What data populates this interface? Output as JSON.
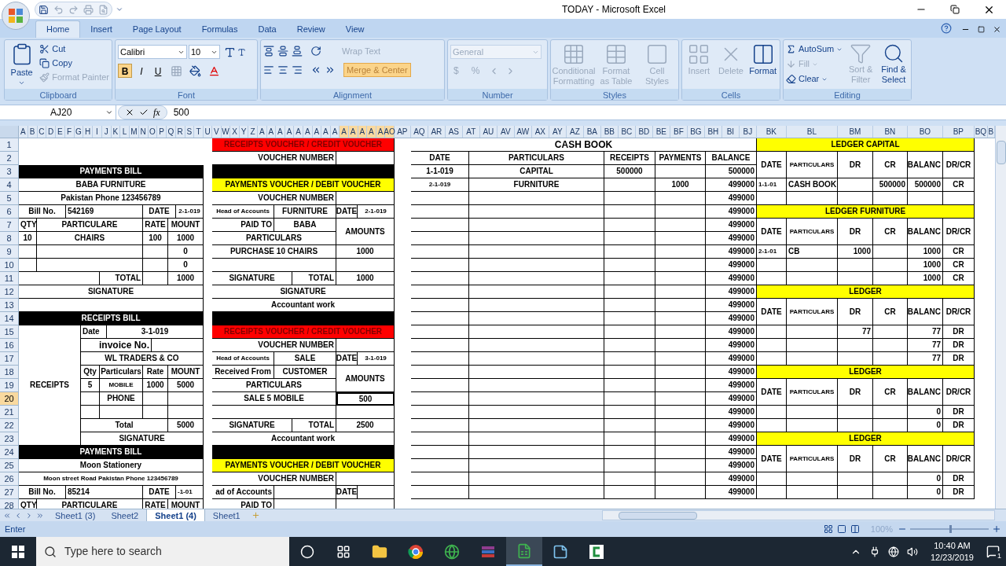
{
  "window": {
    "title": "TODAY - Microsoft Excel"
  },
  "ribbon_tabs": [
    {
      "label": "Home",
      "selected": true
    },
    {
      "label": "Insert",
      "selected": false
    },
    {
      "label": "Page Layout",
      "selected": false
    },
    {
      "label": "Formulas",
      "selected": false
    },
    {
      "label": "Data",
      "selected": false
    },
    {
      "label": "Review",
      "selected": false
    },
    {
      "label": "View",
      "selected": false
    }
  ],
  "clipboard": {
    "label": "Clipboard",
    "paste": "Paste",
    "items": [
      {
        "kind": "cut",
        "label": "Cut",
        "disabled": false
      },
      {
        "kind": "copy",
        "label": "Copy",
        "disabled": false
      },
      {
        "kind": "painter",
        "label": "Format Painter",
        "disabled": true
      }
    ]
  },
  "font": {
    "label": "Font",
    "font_name": "Calibri",
    "font_size": "10",
    "style_buttons": [
      {
        "kind": "bold",
        "label": "B",
        "selected": true
      },
      {
        "kind": "italic",
        "label": "I",
        "selected": false
      },
      {
        "kind": "underline",
        "label": "U",
        "selected": false
      }
    ]
  },
  "alignment": {
    "label": "Alignment",
    "wrap_text": {
      "label": "Wrap Text",
      "disabled": true
    },
    "merge": {
      "label": "Merge & Center",
      "selected": true
    }
  },
  "number": {
    "label": "Number",
    "format": "General",
    "currency": "$",
    "percent": "%"
  },
  "styles": {
    "label": "Styles",
    "buttons": [
      {
        "kind": "conditional",
        "label": "Conditional Formatting",
        "disabled": true
      },
      {
        "kind": "table",
        "label": "Format as Table",
        "disabled": true
      },
      {
        "kind": "cellstyle",
        "label": "Cell Styles",
        "disabled": true
      }
    ]
  },
  "cells_group": {
    "label": "Cells",
    "buttons": [
      {
        "kind": "insert",
        "label": "Insert",
        "disabled": true
      },
      {
        "kind": "delete",
        "label": "Delete",
        "disabled": true
      },
      {
        "kind": "format",
        "label": "Format",
        "disabled": false
      }
    ]
  },
  "editing": {
    "label": "Editing",
    "items": [
      {
        "kind": "autosum",
        "label": "AutoSum",
        "disabled": false
      },
      {
        "kind": "fill",
        "label": "Fill",
        "disabled": true
      },
      {
        "kind": "clear",
        "label": "Clear",
        "disabled": false
      }
    ],
    "buttons": [
      {
        "kind": "sort",
        "label": "Sort & Filter",
        "disabled": true
      },
      {
        "kind": "find",
        "label": "Find & Select",
        "disabled": false
      }
    ]
  },
  "formula_bar": {
    "name_box": "AJ20",
    "function_label": "fx",
    "value": "500"
  },
  "column_headers": [
    {
      "label": "A",
      "selected": false
    },
    {
      "label": "B",
      "selected": false
    },
    {
      "label": "C",
      "selected": false
    },
    {
      "label": "D",
      "selected": false
    },
    {
      "label": "E",
      "selected": false
    },
    {
      "label": "F",
      "selected": false
    },
    {
      "label": "G",
      "selected": false
    },
    {
      "label": "H",
      "selected": false
    },
    {
      "label": "I",
      "selected": false
    },
    {
      "label": "J",
      "selected": false
    },
    {
      "label": "K",
      "selected": false
    },
    {
      "label": "L",
      "selected": false
    },
    {
      "label": "M",
      "selected": false
    },
    {
      "label": "N",
      "selected": false
    },
    {
      "label": "O",
      "selected": false
    },
    {
      "label": "P",
      "selected": false
    },
    {
      "label": "Q",
      "selected": false
    },
    {
      "label": "R",
      "selected": false
    },
    {
      "label": "S",
      "selected": false
    },
    {
      "label": "T",
      "selected": false
    },
    {
      "label": "U",
      "selected": false
    },
    {
      "label": "V",
      "selected": false
    },
    {
      "label": "W",
      "selected": false
    },
    {
      "label": "X",
      "selected": false
    },
    {
      "label": "Y",
      "selected": false
    },
    {
      "label": "Z",
      "selected": false
    },
    {
      "label": "A",
      "selected": false
    },
    {
      "label": "A",
      "selected": false
    },
    {
      "label": "A",
      "selected": false
    },
    {
      "label": "A",
      "selected": false
    },
    {
      "label": "A",
      "selected": false
    },
    {
      "label": "A",
      "selected": false
    },
    {
      "label": "A",
      "selected": false
    },
    {
      "label": "A",
      "selected": false
    },
    {
      "label": "A",
      "selected": false
    },
    {
      "label": "A",
      "selected": true
    },
    {
      "label": "A",
      "selected": true
    },
    {
      "label": "A",
      "selected": true
    },
    {
      "label": "A",
      "selected": true
    },
    {
      "label": "A",
      "selected": true
    },
    {
      "label": "AO",
      "selected": true
    },
    {
      "label": "AP",
      "selected": false
    },
    {
      "label": "AQ",
      "selected": false
    },
    {
      "label": "AR",
      "selected": false
    },
    {
      "label": "AS",
      "selected": false
    },
    {
      "label": "AT",
      "selected": false
    },
    {
      "label": "AU",
      "selected": false
    },
    {
      "label": "AV",
      "selected": false
    },
    {
      "label": "AW",
      "selected": false
    },
    {
      "label": "AX",
      "selected": false
    },
    {
      "label": "AY",
      "selected": false
    },
    {
      "label": "AZ",
      "selected": false
    },
    {
      "label": "BA",
      "selected": false
    },
    {
      "label": "BB",
      "selected": false
    },
    {
      "label": "BC",
      "selected": false
    },
    {
      "label": "BD",
      "selected": false
    },
    {
      "label": "BE",
      "selected": false
    },
    {
      "label": "BF",
      "selected": false
    },
    {
      "label": "BG",
      "selected": false
    },
    {
      "label": "BH",
      "selected": false
    },
    {
      "label": "BI",
      "selected": false
    },
    {
      "label": "BJ",
      "selected": false
    },
    {
      "label": "BK",
      "selected": false
    },
    {
      "label": "BL",
      "selected": false
    },
    {
      "label": "BM",
      "selected": false
    },
    {
      "label": "BN",
      "selected": false
    },
    {
      "label": "BO",
      "selected": false
    },
    {
      "label": "BP",
      "selected": false
    },
    {
      "label": "BQ",
      "selected": false
    },
    {
      "label": "B",
      "selected": false
    }
  ],
  "rows": [
    {
      "number": "1",
      "selected": false,
      "cells": [
        {
          "text": "RECEIPTS VOUCHER / CREDIT VOUCHER",
          "color": "#ff0000"
        },
        {
          "text": "CASH BOOK"
        },
        {
          "text": "LEDGER CAPITAL",
          "color": "#ffff00"
        }
      ]
    },
    {
      "number": "2",
      "selected": false,
      "cells": [
        {
          "text": "VOUCHER NUMBER"
        },
        {
          "text": "DATE"
        },
        {
          "text": "PARTICULARS"
        },
        {
          "text": "RECEIPTS"
        },
        {
          "text": "PAYMENTS"
        },
        {
          "text": "BALANCE"
        },
        {
          "text": "DATE"
        },
        {
          "text": "PARTICULARS"
        },
        {
          "text": "DR"
        },
        {
          "text": "CR"
        },
        {
          "text": "BALANC"
        },
        {
          "text": "DR/CR"
        }
      ]
    },
    {
      "number": "3",
      "selected": false,
      "cells": [
        {
          "text": "PAYMENTS BILL",
          "color": "#000000"
        },
        {
          "text": "1-1-019"
        },
        {
          "text": "CAPITAL"
        },
        {
          "text": "500000"
        },
        {
          "text": "500000"
        }
      ]
    },
    {
      "number": "4",
      "selected": false,
      "cells": [
        {
          "text": "BABA FURNITURE"
        },
        {
          "text": "PAYMENTS VOUCHER / DEBIT VOUCHER",
          "color": "#ffff00"
        },
        {
          "text": "2-1-019"
        },
        {
          "text": "FURNITURE"
        },
        {
          "text": "1000"
        },
        {
          "text": "499000"
        },
        {
          "text": "1-1-01"
        },
        {
          "text": "CASH BOOK"
        },
        {
          "text": "500000"
        },
        {
          "text": "500000"
        },
        {
          "text": "CR"
        }
      ]
    },
    {
      "number": "5",
      "selected": false,
      "cells": [
        {
          "text": "Pakistan Phone 123456789"
        },
        {
          "text": "VOUCHER NUMBER"
        },
        {
          "text": "499000"
        }
      ]
    },
    {
      "number": "6",
      "selected": false,
      "cells": [
        {
          "text": "Bill No."
        },
        {
          "text": "542169"
        },
        {
          "text": "DATE"
        },
        {
          "text": "2-1-019"
        },
        {
          "text": "Head of Accounts"
        },
        {
          "text": "FURNITURE"
        },
        {
          "text": "DATE"
        },
        {
          "text": "2-1-019"
        },
        {
          "text": "499000"
        },
        {
          "text": "LEDGER FURNITURE",
          "color": "#ffff00"
        }
      ]
    },
    {
      "number": "7",
      "selected": false,
      "cells": [
        {
          "text": "QTY"
        },
        {
          "text": "PARTICULARE"
        },
        {
          "text": "RATE"
        },
        {
          "text": "MOUNT"
        },
        {
          "text": "PAID TO"
        },
        {
          "text": "BABA"
        },
        {
          "text": "AMOUNTS"
        },
        {
          "text": "499000"
        },
        {
          "text": "DATE"
        },
        {
          "text": "PARTICULARS"
        },
        {
          "text": "DR"
        },
        {
          "text": "CR"
        },
        {
          "text": "BALANC"
        },
        {
          "text": "DR/CR"
        }
      ]
    },
    {
      "number": "8",
      "selected": false,
      "cells": [
        {
          "text": "10"
        },
        {
          "text": "CHAIRS"
        },
        {
          "text": "100"
        },
        {
          "text": "1000"
        },
        {
          "text": "PARTICULARS"
        },
        {
          "text": "499000"
        }
      ]
    },
    {
      "number": "9",
      "selected": false,
      "cells": [
        {
          "text": "0"
        },
        {
          "text": "PURCHASE 10 CHAIRS"
        },
        {
          "text": "1000"
        },
        {
          "text": "499000"
        },
        {
          "text": "2-1-01"
        },
        {
          "text": "CB"
        },
        {
          "text": "1000"
        },
        {
          "text": "1000"
        },
        {
          "text": "CR"
        }
      ]
    },
    {
      "number": "10",
      "selected": false,
      "cells": [
        {
          "text": "0"
        },
        {
          "text": "499000"
        },
        {
          "text": "1000"
        },
        {
          "text": "CR"
        }
      ]
    },
    {
      "number": "11",
      "selected": false,
      "cells": [
        {
          "text": "TOTAL"
        },
        {
          "text": "1000"
        },
        {
          "text": "SIGNATURE"
        },
        {
          "text": "TOTAL"
        },
        {
          "text": "1000"
        },
        {
          "text": "499000"
        },
        {
          "text": "1000"
        },
        {
          "text": "CR"
        }
      ]
    },
    {
      "number": "12",
      "selected": false,
      "cells": [
        {
          "text": "SIGNATURE"
        },
        {
          "text": "SIGNATURE"
        },
        {
          "text": "499000"
        },
        {
          "text": "LEDGER",
          "color": "#ffff00"
        }
      ]
    },
    {
      "number": "13",
      "selected": false,
      "cells": [
        {
          "text": "Accountant work"
        },
        {
          "text": "499000"
        },
        {
          "text": "DATE"
        },
        {
          "text": "PARTICULARS"
        },
        {
          "text": "DR"
        },
        {
          "text": "CR"
        },
        {
          "text": "BALANC"
        },
        {
          "text": "DR/CR"
        }
      ]
    },
    {
      "number": "14",
      "selected": false,
      "cells": [
        {
          "text": "RECEIPTS BILL",
          "color": "#000000"
        },
        {
          "text": "499000"
        }
      ]
    },
    {
      "number": "15",
      "selected": false,
      "cells": [
        {
          "text": "RECEIPTS"
        },
        {
          "text": "Date"
        },
        {
          "text": "3-1-019"
        },
        {
          "text": "RECEIPTS VOUCHER / CREDIT VOUCHER",
          "color": "#ff0000"
        },
        {
          "text": "499000"
        },
        {
          "text": "77"
        },
        {
          "text": "77"
        },
        {
          "text": "DR"
        }
      ]
    },
    {
      "number": "16",
      "selected": false,
      "cells": [
        {
          "text": "invoice No."
        },
        {
          "text": "VOUCHER NUMBER"
        },
        {
          "text": "499000"
        },
        {
          "text": "77"
        },
        {
          "text": "DR"
        }
      ]
    },
    {
      "number": "17",
      "selected": false,
      "cells": [
        {
          "text": "WL TRADERS & CO"
        },
        {
          "text": "Head of Accounts"
        },
        {
          "text": "SALE"
        },
        {
          "text": "DATE"
        },
        {
          "text": "3-1-019"
        },
        {
          "text": "499000"
        },
        {
          "text": "77"
        },
        {
          "text": "DR"
        }
      ]
    },
    {
      "number": "18",
      "selected": false,
      "cells": [
        {
          "text": "Qty"
        },
        {
          "text": "Particulars"
        },
        {
          "text": "Rate"
        },
        {
          "text": "MOUNT"
        },
        {
          "text": "Received From"
        },
        {
          "text": "CUSTOMER"
        },
        {
          "text": "AMOUNTS"
        },
        {
          "text": "499000"
        },
        {
          "text": "LEDGER",
          "color": "#ffff00"
        }
      ]
    },
    {
      "number": "19",
      "selected": false,
      "cells": [
        {
          "text": "5"
        },
        {
          "text": "MOBILE"
        },
        {
          "text": "1000"
        },
        {
          "text": "5000"
        },
        {
          "text": "PARTICULARS"
        },
        {
          "text": "499000"
        },
        {
          "text": "DATE"
        },
        {
          "text": "PARTICULARS"
        },
        {
          "text": "DR"
        },
        {
          "text": "CR"
        },
        {
          "text": "BALANC"
        },
        {
          "text": "DR/CR"
        }
      ]
    },
    {
      "number": "20",
      "selected": true,
      "cells": [
        {
          "text": "PHONE"
        },
        {
          "text": "SALE 5 MOBILE"
        },
        {
          "text": "500"
        },
        {
          "text": "499000"
        }
      ]
    },
    {
      "number": "21",
      "selected": false,
      "cells": [
        {
          "text": "499000"
        },
        {
          "text": "0"
        },
        {
          "text": "DR"
        }
      ]
    },
    {
      "number": "22",
      "selected": false,
      "cells": [
        {
          "text": "Total"
        },
        {
          "text": "5000"
        },
        {
          "text": "SIGNATURE"
        },
        {
          "text": "TOTAL"
        },
        {
          "text": "2500"
        },
        {
          "text": "499000"
        },
        {
          "text": "0"
        },
        {
          "text": "DR"
        }
      ]
    },
    {
      "number": "23",
      "selected": false,
      "cells": [
        {
          "text": "SIGNATURE"
        },
        {
          "text": "Accountant work"
        },
        {
          "text": "499000"
        },
        {
          "text": "LEDGER",
          "color": "#ffff00"
        }
      ]
    },
    {
      "number": "24",
      "selected": false,
      "cells": [
        {
          "text": "PAYMENTS BILL",
          "color": "#000000"
        },
        {
          "text": "499000"
        },
        {
          "text": "DATE"
        },
        {
          "text": "PARTICULARS"
        },
        {
          "text": "DR"
        },
        {
          "text": "CR"
        },
        {
          "text": "BALANC"
        },
        {
          "text": "DR/CR"
        }
      ]
    },
    {
      "number": "25",
      "selected": false,
      "cells": [
        {
          "text": "Moon Stationery"
        },
        {
          "text": "PAYMENTS VOUCHER / DEBIT VOUCHER",
          "color": "#ffff00"
        },
        {
          "text": "499000"
        }
      ]
    },
    {
      "number": "26",
      "selected": false,
      "cells": [
        {
          "text": "Moon street Road Pakistan Phone 123456789"
        },
        {
          "text": "VOUCHER NUMBER"
        },
        {
          "text": "499000"
        },
        {
          "text": "0"
        },
        {
          "text": "DR"
        }
      ]
    },
    {
      "number": "27",
      "selected": false,
      "cells": [
        {
          "text": "Bill No."
        },
        {
          "text": "85214"
        },
        {
          "text": "DATE"
        },
        {
          "text": "-1-01"
        },
        {
          "text": "ad of Accounts"
        },
        {
          "text": "DATE"
        },
        {
          "text": "499000"
        },
        {
          "text": "0"
        },
        {
          "text": "DR"
        }
      ]
    },
    {
      "number": "28",
      "selected": false,
      "cells": [
        {
          "text": "QTY"
        },
        {
          "text": "PARTICULARE"
        },
        {
          "text": "RATE"
        },
        {
          "text": "MOUNT"
        },
        {
          "text": "PAID TO"
        }
      ]
    }
  ],
  "sheet_tabs": [
    {
      "label": "Sheet1 (3)",
      "selected": false
    },
    {
      "label": "Sheet2",
      "selected": false
    },
    {
      "label": "Sheet1 (4)",
      "selected": true
    },
    {
      "label": "Sheet1",
      "selected": false
    }
  ],
  "status_bar": {
    "mode": "Enter",
    "zoom": {
      "label": "100%",
      "level": 0.5
    }
  },
  "taskbar": {
    "search_placeholder": "Type here to search",
    "time": "10:40 AM",
    "date": "12/23/2019",
    "notifications": "1",
    "apps": [
      {
        "kind": "cortana",
        "selected": false
      },
      {
        "kind": "taskview",
        "selected": false
      },
      {
        "kind": "folder",
        "selected": false
      },
      {
        "kind": "chrome",
        "selected": false
      },
      {
        "kind": "globe",
        "selected": false
      },
      {
        "kind": "archive",
        "selected": false
      },
      {
        "kind": "excel",
        "selected": true
      },
      {
        "kind": "notes",
        "selected": false
      },
      {
        "kind": "recorder",
        "selected": false
      }
    ]
  }
}
